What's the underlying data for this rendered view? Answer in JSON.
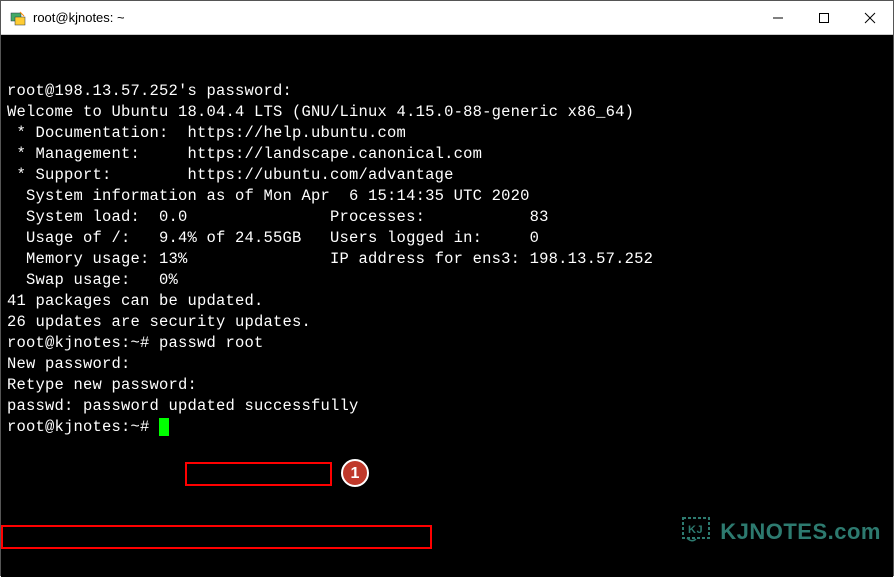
{
  "window": {
    "title": "root@kjnotes: ~"
  },
  "terminal": {
    "lines": [
      "root@198.13.57.252's password:",
      "Welcome to Ubuntu 18.04.4 LTS (GNU/Linux 4.15.0-88-generic x86_64)",
      "",
      " * Documentation:  https://help.ubuntu.com",
      " * Management:     https://landscape.canonical.com",
      " * Support:        https://ubuntu.com/advantage",
      "",
      "  System information as of Mon Apr  6 15:14:35 UTC 2020",
      "",
      "  System load:  0.0               Processes:           83",
      "  Usage of /:   9.4% of 24.55GB   Users logged in:     0",
      "  Memory usage: 13%               IP address for ens3: 198.13.57.252",
      "  Swap usage:   0%",
      "",
      "",
      "41 packages can be updated.",
      "26 updates are security updates.",
      "",
      "",
      "root@kjnotes:~# passwd root",
      "New password:",
      "Retype new password:",
      "passwd: password updated successfully",
      "root@kjnotes:~# "
    ],
    "cursor_line_index": 23
  },
  "annotation": {
    "badge": "1"
  },
  "watermark": {
    "text": "KJNOTES.com"
  }
}
